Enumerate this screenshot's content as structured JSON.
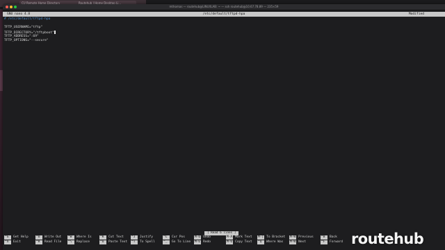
{
  "browser": {
    "tabs": [
      "CU Remote Home Directory",
      "Routehub | Home Desktop Li..."
    ]
  },
  "window": {
    "title": "mthomas — routehub@LINUXLAB: ~ — ssh routehub@10.67.78.89 — 235×59"
  },
  "nano": {
    "version": "GNU nano 4.8",
    "filename": "/etc/default/tftpd-hpa",
    "state": "Modified"
  },
  "editor": {
    "lines": [
      "# /etc/default/tftpd-hpa",
      "",
      "TFTP_USERNAME=\"tftp\"",
      "TFTP_DIRECTORY=\"/tftpboot\"",
      "TFTP_ADDRESS=\":69\"",
      "TFTP_OPTIONS=\"--secure\""
    ]
  },
  "status": {
    "message": "[ Read 6 lines ]"
  },
  "shortcuts": [
    {
      "key": "^G",
      "label": "Get Help"
    },
    {
      "key": "^X",
      "label": "Exit"
    },
    {
      "key": "^O",
      "label": "Write Out"
    },
    {
      "key": "^R",
      "label": "Read File"
    },
    {
      "key": "^W",
      "label": "Where Is"
    },
    {
      "key": "^\\",
      "label": "Replace"
    },
    {
      "key": "^K",
      "label": "Cut Text"
    },
    {
      "key": "^U",
      "label": "Paste Text"
    },
    {
      "key": "^J",
      "label": "Justify"
    },
    {
      "key": "^T",
      "label": "To Spell"
    },
    {
      "key": "^C",
      "label": "Cur Pos"
    },
    {
      "key": "^_",
      "label": "Go To Line"
    },
    {
      "key": "M-U",
      "label": "Undo"
    },
    {
      "key": "M-E",
      "label": "Redo"
    },
    {
      "key": "M-A",
      "label": "Mark Text"
    },
    {
      "key": "M-6",
      "label": "Copy Text"
    },
    {
      "key": "M-]",
      "label": "To Bracket"
    },
    {
      "key": "^Q",
      "label": "Where Was"
    },
    {
      "key": "M-W",
      "label": "Previous"
    },
    {
      "key": "M-W",
      "label": "Next"
    },
    {
      "key": "^B",
      "label": "Back"
    },
    {
      "key": "^F",
      "label": "Forward"
    }
  ],
  "watermark": {
    "text": "routehub"
  }
}
